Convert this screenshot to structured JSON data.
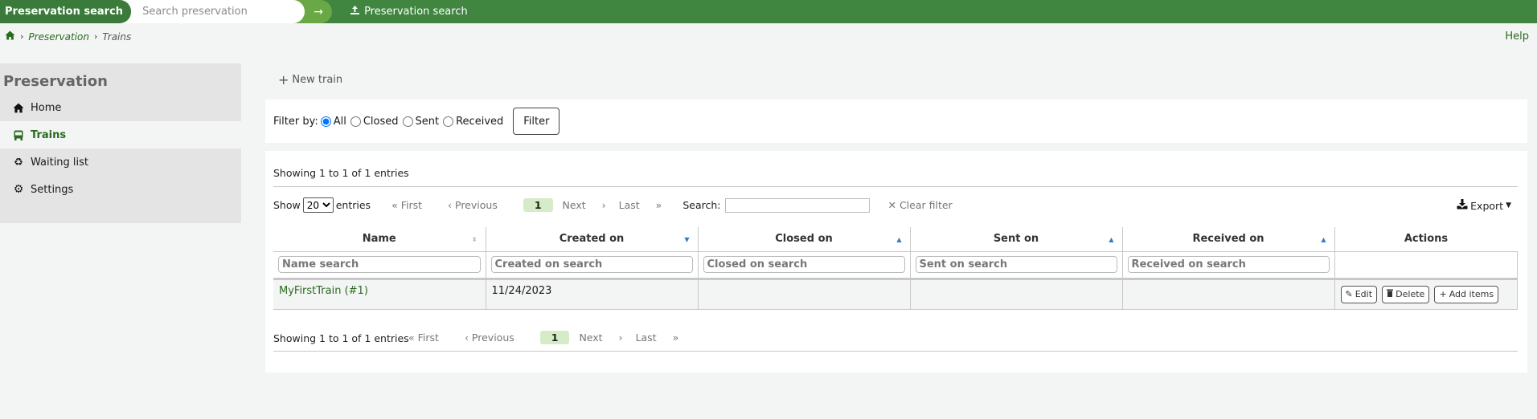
{
  "topbar": {
    "label": "Preservation search",
    "search_placeholder": "Search preservation",
    "search_value": "",
    "link_label": "Preservation search"
  },
  "breadcrumb": {
    "items": [
      "Preservation",
      "Trains"
    ]
  },
  "help_label": "Help",
  "sidebar": {
    "title": "Preservation",
    "items": [
      {
        "label": "Home",
        "icon": "home-icon",
        "active": false
      },
      {
        "label": "Trains",
        "icon": "bus-icon",
        "active": true
      },
      {
        "label": "Waiting list",
        "icon": "recycle-icon",
        "active": false
      },
      {
        "label": "Settings",
        "icon": "gear-icon",
        "active": false
      }
    ]
  },
  "toolbar": {
    "new_train_label": "New train"
  },
  "filter": {
    "label": "Filter by:",
    "options": [
      "All",
      "Closed",
      "Sent",
      "Received"
    ],
    "selected": "All",
    "button_label": "Filter"
  },
  "table": {
    "info_top": "Showing 1 to 1 of 1 entries",
    "info_bottom": "Showing 1 to 1 of 1 entries",
    "show_label": "Show",
    "entries_label": "entries",
    "page_size": "20",
    "pager": {
      "first": "First",
      "previous": "Previous",
      "current": "1",
      "next": "Next",
      "last": "Last"
    },
    "search_label": "Search:",
    "search_value": "",
    "clear_filter_label": "Clear filter",
    "export_label": "Export",
    "columns": [
      {
        "label": "Name",
        "sort": "both",
        "filter_placeholder": "Name search"
      },
      {
        "label": "Created on",
        "sort": "desc",
        "filter_placeholder": "Created on search"
      },
      {
        "label": "Closed on",
        "sort": "asc",
        "filter_placeholder": "Closed on search"
      },
      {
        "label": "Sent on",
        "sort": "asc",
        "filter_placeholder": "Sent on search"
      },
      {
        "label": "Received on",
        "sort": "asc",
        "filter_placeholder": "Received on search"
      },
      {
        "label": "Actions",
        "sort": "none",
        "filter_placeholder": ""
      }
    ],
    "rows": [
      {
        "name": "MyFirstTrain (#1)",
        "created_on": "11/24/2023",
        "closed_on": "",
        "sent_on": "",
        "received_on": ""
      }
    ],
    "row_actions": {
      "edit": "Edit",
      "delete": "Delete",
      "add_items": "Add items"
    }
  },
  "colors": {
    "topbar": "#408540",
    "accent_green": "#6aa845",
    "link_green": "#2a6b1e",
    "sort_blue": "#3a78c8",
    "current_page": "#d6ecc8"
  }
}
